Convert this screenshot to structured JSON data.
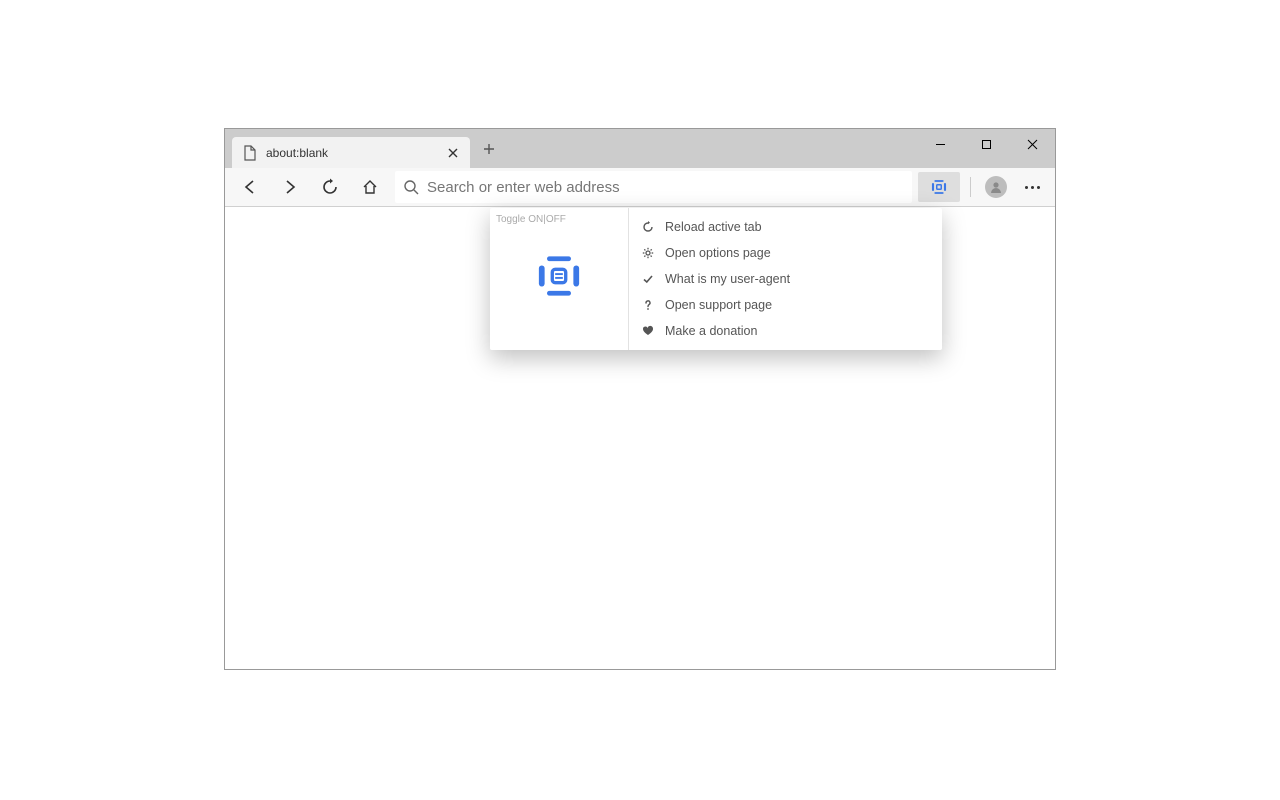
{
  "tab": {
    "title": "about:blank"
  },
  "addressbar": {
    "placeholder": "Search or enter web address",
    "value": ""
  },
  "popup": {
    "toggle_label": "Toggle ON|OFF",
    "menu": [
      {
        "label": "Reload active tab"
      },
      {
        "label": "Open options page"
      },
      {
        "label": "What is my user-agent"
      },
      {
        "label": "Open support page"
      },
      {
        "label": "Make a donation"
      }
    ]
  }
}
